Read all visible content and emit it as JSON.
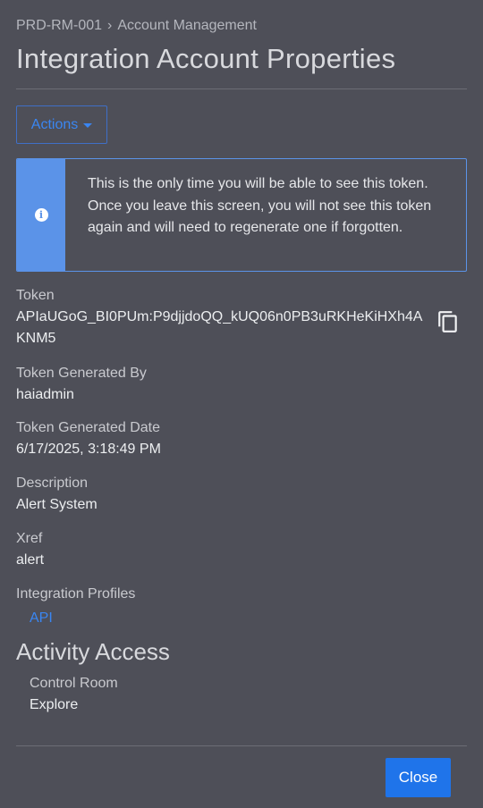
{
  "breadcrumb": {
    "parent": "PRD-RM-001",
    "separator": "›",
    "current": "Account Management"
  },
  "page_title": "Integration Account Properties",
  "actions": {
    "label": "Actions"
  },
  "alert": {
    "icon": "info-icon",
    "message": "This is the only time you will be able to see this token. Once you leave this screen, you will not see this token again and will need to regenerate one if forgotten."
  },
  "fields": {
    "token": {
      "label": "Token",
      "value": "APIaUGoG_BI0PUm:P9djjdoQQ_kUQ06n0PB3uRKHeKiHXh4AKNM5",
      "copy_icon": "copy-icon"
    },
    "generated_by": {
      "label": "Token Generated By",
      "value": "haiadmin"
    },
    "generated_date": {
      "label": "Token Generated Date",
      "value": "6/17/2025, 3:18:49 PM"
    },
    "description": {
      "label": "Description",
      "value": "Alert System"
    },
    "xref": {
      "label": "Xref",
      "value": "alert"
    },
    "integration_profiles": {
      "label": "Integration Profiles",
      "items": [
        "API"
      ]
    }
  },
  "activity_access": {
    "title": "Activity Access",
    "items": [
      "Control Room",
      "Explore"
    ]
  },
  "footer": {
    "close_label": "Close"
  },
  "colors": {
    "background": "#4e4f58",
    "accent": "#1f74ea",
    "link": "#3a86f2",
    "alert_border": "#5b93e8"
  }
}
